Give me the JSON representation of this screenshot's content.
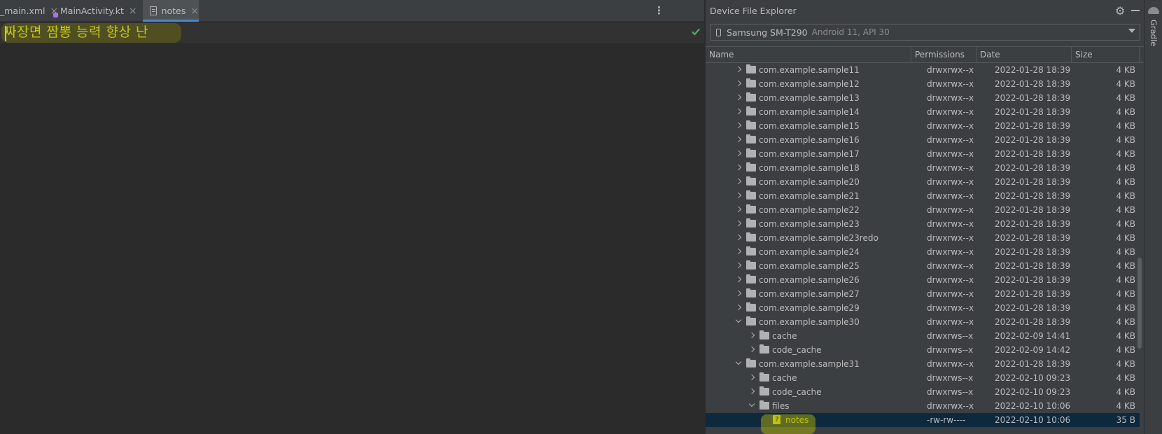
{
  "editor": {
    "tabs": [
      {
        "label": "_main.xml",
        "icon": "xml-file-icon",
        "active": false
      },
      {
        "label": "MainActivity.kt",
        "icon": "kotlin-file-icon",
        "active": false
      },
      {
        "label": "notes",
        "icon": "text-file-icon",
        "active": true
      }
    ],
    "close_glyph": "×",
    "menu_glyph": "⋮",
    "content": "짜장면 짬뽕 능력 향상 난",
    "status_icon": "check-icon",
    "status_color": "#59a869"
  },
  "explorer": {
    "title": "Device File Explorer",
    "settings_icon": "gear-icon",
    "minimize_icon": "minimize-icon",
    "device": {
      "name": "Samsung SM-T290",
      "os": "Android 11, API 30"
    },
    "columns": [
      "Name",
      "Permissions",
      "Date",
      "Size"
    ],
    "rows": [
      {
        "name": "com.example.sample11",
        "permissions": "drwxrwx--x",
        "date": "2022-01-28 18:39",
        "size": "4 KB",
        "type": "folder",
        "level": 0,
        "expanded": false
      },
      {
        "name": "com.example.sample12",
        "permissions": "drwxrwx--x",
        "date": "2022-01-28 18:39",
        "size": "4 KB",
        "type": "folder",
        "level": 0,
        "expanded": false
      },
      {
        "name": "com.example.sample13",
        "permissions": "drwxrwx--x",
        "date": "2022-01-28 18:39",
        "size": "4 KB",
        "type": "folder",
        "level": 0,
        "expanded": false
      },
      {
        "name": "com.example.sample14",
        "permissions": "drwxrwx--x",
        "date": "2022-01-28 18:39",
        "size": "4 KB",
        "type": "folder",
        "level": 0,
        "expanded": false
      },
      {
        "name": "com.example.sample15",
        "permissions": "drwxrwx--x",
        "date": "2022-01-28 18:39",
        "size": "4 KB",
        "type": "folder",
        "level": 0,
        "expanded": false
      },
      {
        "name": "com.example.sample16",
        "permissions": "drwxrwx--x",
        "date": "2022-01-28 18:39",
        "size": "4 KB",
        "type": "folder",
        "level": 0,
        "expanded": false
      },
      {
        "name": "com.example.sample17",
        "permissions": "drwxrwx--x",
        "date": "2022-01-28 18:39",
        "size": "4 KB",
        "type": "folder",
        "level": 0,
        "expanded": false
      },
      {
        "name": "com.example.sample18",
        "permissions": "drwxrwx--x",
        "date": "2022-01-28 18:39",
        "size": "4 KB",
        "type": "folder",
        "level": 0,
        "expanded": false
      },
      {
        "name": "com.example.sample20",
        "permissions": "drwxrwx--x",
        "date": "2022-01-28 18:39",
        "size": "4 KB",
        "type": "folder",
        "level": 0,
        "expanded": false
      },
      {
        "name": "com.example.sample21",
        "permissions": "drwxrwx--x",
        "date": "2022-01-28 18:39",
        "size": "4 KB",
        "type": "folder",
        "level": 0,
        "expanded": false
      },
      {
        "name": "com.example.sample22",
        "permissions": "drwxrwx--x",
        "date": "2022-01-28 18:39",
        "size": "4 KB",
        "type": "folder",
        "level": 0,
        "expanded": false
      },
      {
        "name": "com.example.sample23",
        "permissions": "drwxrwx--x",
        "date": "2022-01-28 18:39",
        "size": "4 KB",
        "type": "folder",
        "level": 0,
        "expanded": false
      },
      {
        "name": "com.example.sample23redo",
        "permissions": "drwxrwx--x",
        "date": "2022-01-28 18:39",
        "size": "4 KB",
        "type": "folder",
        "level": 0,
        "expanded": false
      },
      {
        "name": "com.example.sample24",
        "permissions": "drwxrwx--x",
        "date": "2022-01-28 18:39",
        "size": "4 KB",
        "type": "folder",
        "level": 0,
        "expanded": false
      },
      {
        "name": "com.example.sample25",
        "permissions": "drwxrwx--x",
        "date": "2022-01-28 18:39",
        "size": "4 KB",
        "type": "folder",
        "level": 0,
        "expanded": false
      },
      {
        "name": "com.example.sample26",
        "permissions": "drwxrwx--x",
        "date": "2022-01-28 18:39",
        "size": "4 KB",
        "type": "folder",
        "level": 0,
        "expanded": false
      },
      {
        "name": "com.example.sample27",
        "permissions": "drwxrwx--x",
        "date": "2022-01-28 18:39",
        "size": "4 KB",
        "type": "folder",
        "level": 0,
        "expanded": false
      },
      {
        "name": "com.example.sample29",
        "permissions": "drwxrwx--x",
        "date": "2022-01-28 18:39",
        "size": "4 KB",
        "type": "folder",
        "level": 0,
        "expanded": false
      },
      {
        "name": "com.example.sample30",
        "permissions": "drwxrwx--x",
        "date": "2022-01-28 18:39",
        "size": "4 KB",
        "type": "folder",
        "level": 0,
        "expanded": true
      },
      {
        "name": "cache",
        "permissions": "drwxrws--x",
        "date": "2022-02-09 14:41",
        "size": "4 KB",
        "type": "folder",
        "level": 1,
        "expanded": false
      },
      {
        "name": "code_cache",
        "permissions": "drwxrws--x",
        "date": "2022-02-09 14:42",
        "size": "4 KB",
        "type": "folder",
        "level": 1,
        "expanded": false
      },
      {
        "name": "com.example.sample31",
        "permissions": "drwxrwx--x",
        "date": "2022-01-28 18:39",
        "size": "4 KB",
        "type": "folder",
        "level": 0,
        "expanded": true
      },
      {
        "name": "cache",
        "permissions": "drwxrws--x",
        "date": "2022-02-10 09:23",
        "size": "4 KB",
        "type": "folder",
        "level": 1,
        "expanded": false
      },
      {
        "name": "code_cache",
        "permissions": "drwxrws--x",
        "date": "2022-02-10 09:23",
        "size": "4 KB",
        "type": "folder",
        "level": 1,
        "expanded": false
      },
      {
        "name": "files",
        "permissions": "drwxrwx--x",
        "date": "2022-02-10 10:06",
        "size": "4 KB",
        "type": "folder",
        "level": 1,
        "expanded": true
      },
      {
        "name": "notes",
        "permissions": "-rw-rw----",
        "date": "2022-02-10 10:06",
        "size": "35 B",
        "type": "file",
        "level": 2,
        "selected": true
      }
    ]
  },
  "side_strip": {
    "label": "Gradle",
    "icon": "gradle-elephant-icon"
  }
}
